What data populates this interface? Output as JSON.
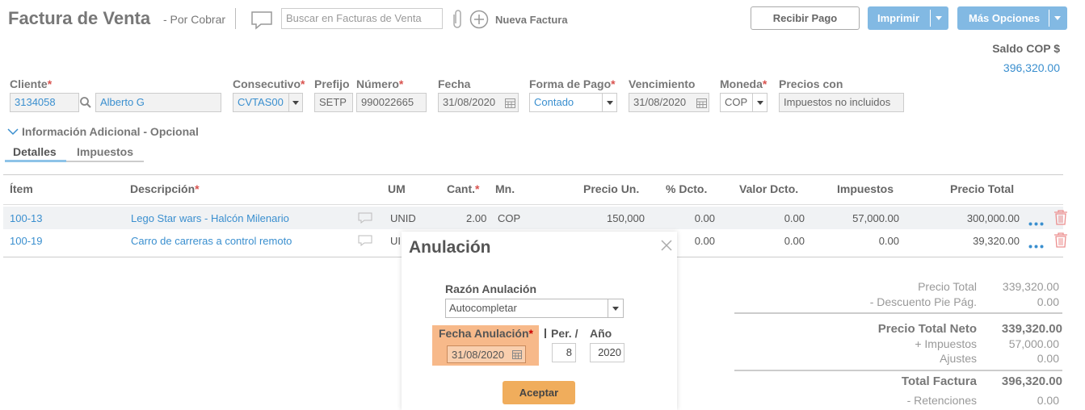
{
  "header": {
    "title": "Factura de Venta",
    "status": "- Por Cobrar",
    "search_placeholder": "Buscar en Facturas de Venta",
    "new_invoice": "Nueva Factura",
    "receive_payment": "Recibir Pago",
    "print": "Imprimir",
    "more_options": "Más Opciones",
    "balance_label": "Saldo COP $",
    "balance_value": "396,320.00"
  },
  "form": {
    "cliente_label": "Cliente",
    "cliente_id": "3134058",
    "cliente_name": "Alberto G",
    "consecutivo_label": "Consecutivo",
    "consecutivo_value": "CVTAS00",
    "prefijo_label": "Prefijo",
    "prefijo_value": "SETP",
    "numero_label": "Número",
    "numero_value": "990022665",
    "fecha_label": "Fecha",
    "fecha_value": "31/08/2020",
    "forma_pago_label": "Forma de Pago",
    "forma_pago_value": "Contado",
    "vencimiento_label": "Vencimiento",
    "vencimiento_value": "31/08/2020",
    "moneda_label": "Moneda",
    "moneda_value": "COP",
    "precios_label": "Precios con",
    "precios_value": "Impuestos no incluidos",
    "info_adicional": "Información Adicional - Opcional"
  },
  "tabs": {
    "detalles": "Detalles",
    "impuestos": "Impuestos"
  },
  "table": {
    "headers": {
      "item": "Ítem",
      "descripcion": "Descripción",
      "um": "UM",
      "cant": "Cant.",
      "mn": "Mn.",
      "precio_un": "Precio Un.",
      "dcto": "% Dcto.",
      "valor_dcto": "Valor Dcto.",
      "impuestos": "Impuestos",
      "precio_total": "Precio Total"
    },
    "rows": [
      {
        "item": "100-13",
        "descripcion": "Lego Star wars - Halcón Milenario",
        "um": "UNID",
        "cant": "2.00",
        "mn": "COP",
        "precio_un": "150,000",
        "dcto": "0.00",
        "valor_dcto": "0.00",
        "impuestos": "57,000.00",
        "precio_total": "300,000.00"
      },
      {
        "item": "100-19",
        "descripcion": "Carro de carreras a control remoto",
        "um": "UI",
        "dcto": "0.00",
        "valor_dcto": "0.00",
        "impuestos": "0.00",
        "precio_total": "39,320.00"
      }
    ]
  },
  "totals": {
    "precio_total_label": "Precio Total",
    "precio_total": "339,320.00",
    "descuento_label": "- Descuento Pie Pág.",
    "descuento": "0.00",
    "neto_label": "Precio Total Neto",
    "neto": "339,320.00",
    "impuestos_label": "+ Impuestos",
    "impuestos": "57,000.00",
    "ajustes_label": "Ajustes",
    "ajustes": "0.00",
    "total_label": "Total Factura",
    "total": "396,320.00",
    "retenciones_label": "- Retenciones",
    "retenciones": "0.00"
  },
  "modal": {
    "title": "Anulación",
    "razon_label": "Razón Anulación",
    "razon_value": "Autocompletar",
    "fecha_label": "Fecha Anulación",
    "fecha_value": "31/08/2020",
    "per_label": "Per. /",
    "per_value": "8",
    "anio_label": "Año",
    "anio_value": "2020",
    "accept": "Aceptar"
  },
  "colors": {
    "accent": "#3a8fcf",
    "button_blue": "#82b9e3",
    "orange": "#f0ad5c",
    "highlight": "#f7b98a"
  }
}
